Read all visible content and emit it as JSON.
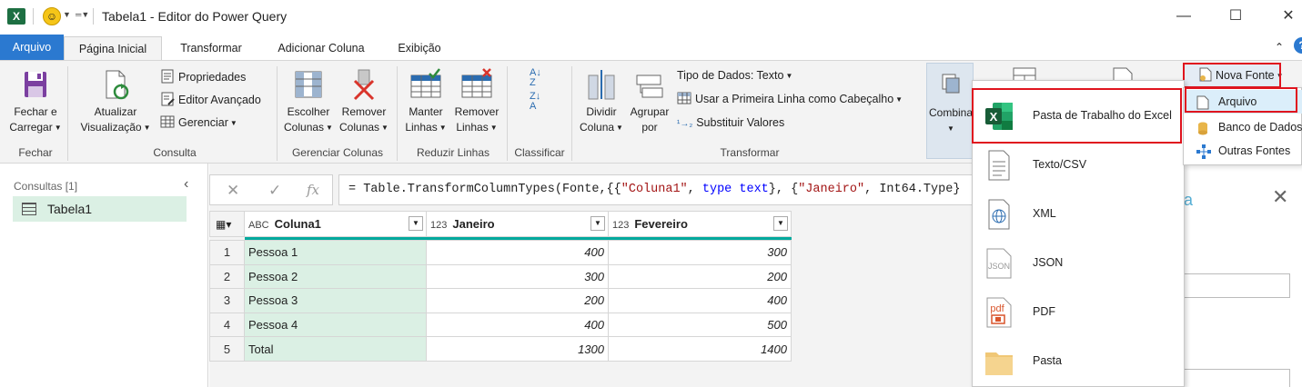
{
  "window": {
    "title": "Tabela1 - Editor do Power Query",
    "app_icon_text": "X"
  },
  "tabs": [
    {
      "label": "Arquivo"
    },
    {
      "label": "Página Inicial"
    },
    {
      "label": "Transformar"
    },
    {
      "label": "Adicionar Coluna"
    },
    {
      "label": "Exibição"
    }
  ],
  "ribbon": {
    "close_load": {
      "line1": "Fechar e",
      "line2": "Carregar"
    },
    "refresh": {
      "line1": "Atualizar",
      "line2": "Visualização"
    },
    "properties": "Propriedades",
    "advanced_editor": "Editor Avançado",
    "manage": "Gerenciar",
    "choose_columns": {
      "line1": "Escolher",
      "line2": "Colunas"
    },
    "remove_columns": {
      "line1": "Remover",
      "line2": "Colunas"
    },
    "keep_rows": {
      "line1": "Manter",
      "line2": "Linhas"
    },
    "remove_rows": {
      "line1": "Remover",
      "line2": "Linhas"
    },
    "split_column": {
      "line1": "Dividir",
      "line2": "Coluna"
    },
    "group_by": {
      "line1": "Agrupar",
      "line2": "por"
    },
    "data_type": "Tipo de Dados: Texto",
    "first_row_header": "Usar a Primeira Linha como Cabeçalho",
    "replace_values": "Substituir Valores",
    "combine": "Combina",
    "new_source": "Nova Fonte",
    "groups": {
      "close": "Fechar",
      "query": "Consulta",
      "manage_columns": "Gerenciar Colunas",
      "reduce_rows": "Reduzir Linhas",
      "sort": "Classificar",
      "transform": "Transformar"
    }
  },
  "queries": {
    "header": "Consultas [1]",
    "items": [
      {
        "name": "Tabela1"
      }
    ]
  },
  "formula_bar": {
    "prefix": "= Table.TransformColumnTypes(Fonte,{{",
    "s1": "\"Coluna1\"",
    "mid1": ", ",
    "kw1": "type text",
    "mid2": "}, {",
    "s2": "\"Janeiro\"",
    "mid3": ", Int64.Type}"
  },
  "grid": {
    "columns": [
      {
        "type_icon": "ABC",
        "name": "Coluna1"
      },
      {
        "type_icon": "123",
        "name": "Janeiro"
      },
      {
        "type_icon": "123",
        "name": "Fevereiro"
      }
    ],
    "rows": [
      {
        "n": "1",
        "c1": "Pessoa 1",
        "jan": "400",
        "fev": "300"
      },
      {
        "n": "2",
        "c1": "Pessoa 2",
        "jan": "300",
        "fev": "200"
      },
      {
        "n": "3",
        "c1": "Pessoa 3",
        "jan": "200",
        "fev": "400"
      },
      {
        "n": "4",
        "c1": "Pessoa 4",
        "jan": "400",
        "fev": "500"
      },
      {
        "n": "5",
        "c1": "Total",
        "jan": "1300",
        "fev": "1400"
      }
    ]
  },
  "file_menu": {
    "items": [
      {
        "label": "Pasta de Trabalho do Excel",
        "icon": "excel-icon"
      },
      {
        "label": "Texto/CSV",
        "icon": "text-file-icon"
      },
      {
        "label": "XML",
        "icon": "xml-file-icon"
      },
      {
        "label": "JSON",
        "icon": "json-file-icon"
      },
      {
        "label": "PDF",
        "icon": "pdf-file-icon"
      },
      {
        "label": "Pasta",
        "icon": "folder-icon"
      }
    ]
  },
  "new_source_menu": {
    "items": [
      {
        "label": "Arquivo",
        "icon": "file-icon"
      },
      {
        "label": "Banco de Dados",
        "icon": "database-icon"
      },
      {
        "label": "Outras Fontes",
        "icon": "other-sources-icon"
      }
    ]
  },
  "colors": {
    "accent_blue": "#2b79d0",
    "excel_green": "#1d6f42",
    "selection_green": "#dbf0e4",
    "highlight_red": "#e0141e",
    "teal": "#00a99d"
  }
}
